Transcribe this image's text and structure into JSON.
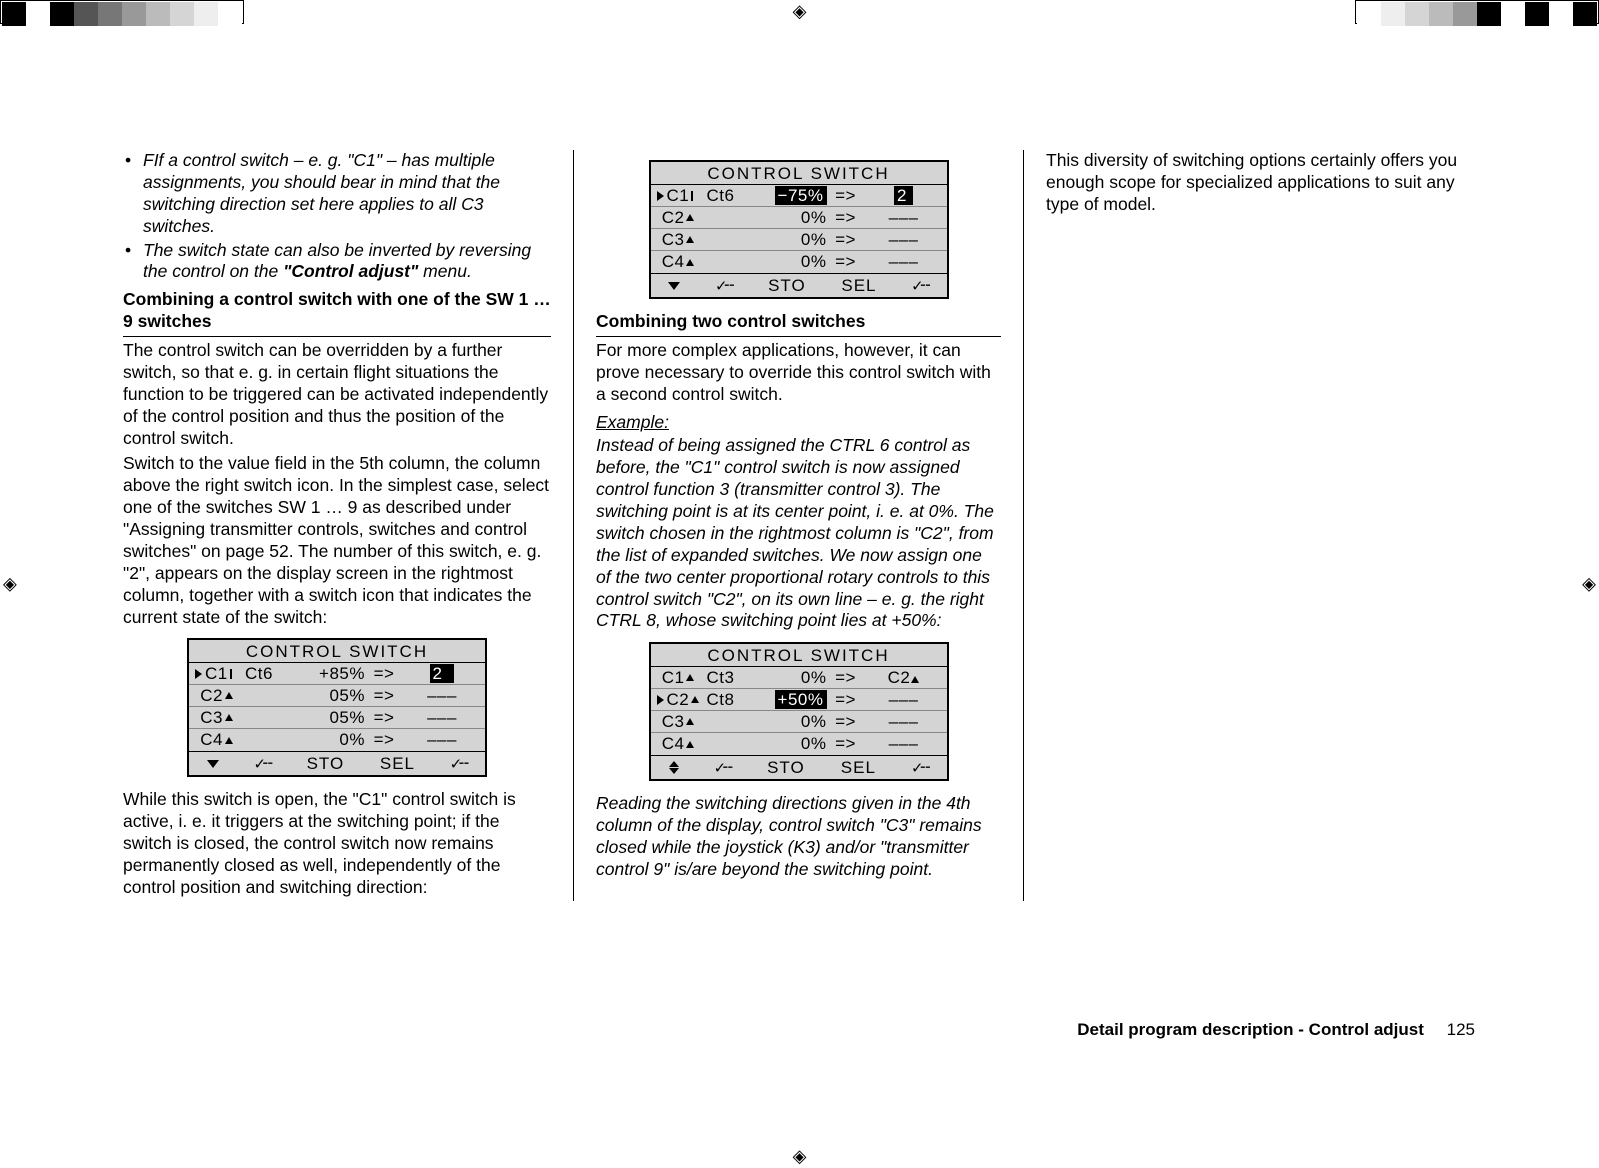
{
  "bullets": {
    "b1": "FIf a control switch – e. g. \"C1\" – has multiple assignments, you should bear in mind that the switching direction set here applies to all C3 switches.",
    "b2_pre": "The switch state can also be inverted by reversing the control on the ",
    "b2_menu": "\"Control adjust\"",
    "b2_post": " menu."
  },
  "h1": "Combining a control switch with one of the SW 1 … 9 switches",
  "p1": "The control switch can be overridden by a further switch, so that e. g. in certain flight situations the function to be triggered can be activated independently of the control position and thus the position of the control switch.",
  "p2": "Switch to the value field in the 5th column, the column above the right switch icon. In the simplest case, select one of the switches SW 1 … 9 as described under \"Assigning transmitter controls, switches and control switches\" on page 52. The number of this switch, e. g. \"2\", appears on the display screen in the rightmost column, together with a switch icon that indicates the current state of the switch:",
  "lcd1": {
    "title": "CONTROL  SWITCH",
    "rows": [
      {
        "sel": true,
        "a": "C1",
        "aicon": "bar",
        "b": "Ct6",
        "c": "+85%",
        "d": "=>",
        "e": "2",
        "eicon": "open",
        "hiE": true
      },
      {
        "sel": false,
        "a": "C2",
        "aicon": "up",
        "b": "",
        "c": "05%",
        "d": "=>",
        "e": "–––"
      },
      {
        "sel": false,
        "a": "C3",
        "aicon": "up",
        "b": "",
        "c": "05%",
        "d": "=>",
        "e": "–––"
      },
      {
        "sel": false,
        "a": "C4",
        "aicon": "up",
        "b": "",
        "c": "0%",
        "d": "=>",
        "e": "–––"
      }
    ],
    "foot_arrow": "down",
    "foot": [
      "STO",
      "SEL"
    ]
  },
  "p3": "While this switch is open, the \"C1\" control switch is active, i. e. it triggers at the switching point; if the switch is closed, the control switch now remains permanently closed as well, independently of the control position and switching direction:",
  "lcd2": {
    "title": "CONTROL  SWITCH",
    "rows": [
      {
        "sel": true,
        "a": "C1",
        "aicon": "bar",
        "b": "Ct6",
        "c": "−75%",
        "d": "=>",
        "e": "2",
        "eicon": "bar",
        "hiC": true,
        "hiE": true
      },
      {
        "sel": false,
        "a": "C2",
        "aicon": "up",
        "b": "",
        "c": "0%",
        "d": "=>",
        "e": "–––"
      },
      {
        "sel": false,
        "a": "C3",
        "aicon": "up",
        "b": "",
        "c": "0%",
        "d": "=>",
        "e": "–––"
      },
      {
        "sel": false,
        "a": "C4",
        "aicon": "up",
        "b": "",
        "c": "0%",
        "d": "=>",
        "e": "–––"
      }
    ],
    "foot_arrow": "down",
    "foot": [
      "STO",
      "SEL"
    ]
  },
  "h2": "Combining two control switches",
  "p4": "For more complex applications, however, it can prove necessary to override this control switch with a second control switch.",
  "ex_label": "Example:",
  "p5": "Instead of being assigned the CTRL 6 control as before, the \"C1\" control switch is now assigned control function 3 (transmitter control 3). The switching point is at its center point, i. e. at 0%. The switch chosen in the rightmost column is \"C2\", from the list of expanded switches. We now assign one of the two center proportional rotary controls to this control switch \"C2\", on its own line – e. g. the right CTRL 8, whose switching point lies at +50%:",
  "lcd3": {
    "title": "CONTROL  SWITCH",
    "rows": [
      {
        "sel": false,
        "a": "C1",
        "aicon": "up",
        "b": "Ct3",
        "c": "0%",
        "d": "=>",
        "e": "C2",
        "eicon": "up"
      },
      {
        "sel": true,
        "a": "C2",
        "aicon": "up",
        "b": "Ct8",
        "c": "+50%",
        "d": "=>",
        "e": "–––",
        "hiC": true
      },
      {
        "sel": false,
        "a": "C3",
        "aicon": "up",
        "b": "",
        "c": "0%",
        "d": "=>",
        "e": "–––"
      },
      {
        "sel": false,
        "a": "C4",
        "aicon": "up",
        "b": "",
        "c": "0%",
        "d": "=>",
        "e": "–––"
      }
    ],
    "foot_arrow": "updown",
    "foot": [
      "STO",
      "SEL"
    ]
  },
  "p6": "Reading the switching directions given in the 4th column of the display, control switch \"C3\" remains closed while the joystick (K3) and/or \"transmitter control 9\" is/are beyond the switching point.",
  "p7": "This diversity of switching options certainly offers you enough scope for specialized applications to suit any type of model.",
  "footer": {
    "label": "Detail program description - Control adjust",
    "page": "125"
  }
}
